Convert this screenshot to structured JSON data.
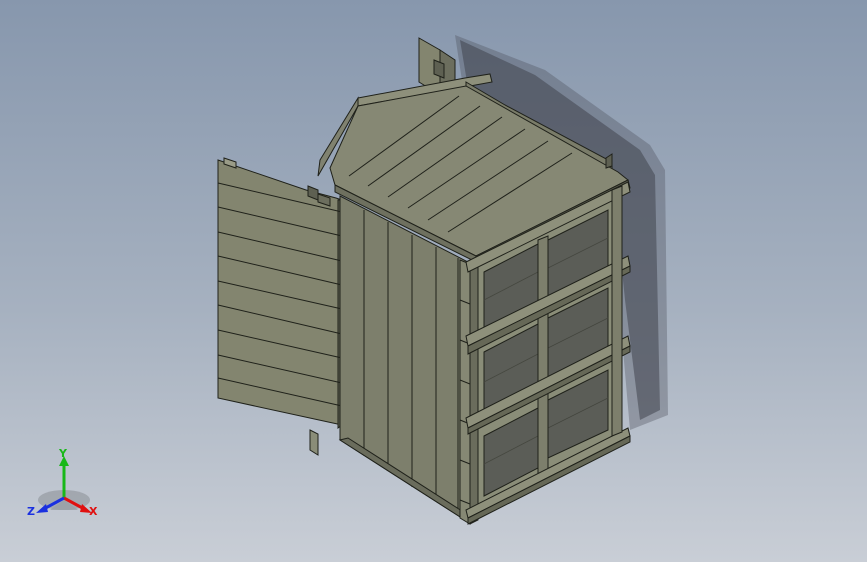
{
  "viewport": {
    "model": "wooden-shed-assembly",
    "view": "isometric",
    "display_style": "shaded-with-edges",
    "background_colors": [
      "#8797ad",
      "#c9ced6"
    ],
    "model_colors": {
      "wall_front": "#7d7f6c",
      "wall_side": "#8a8d78",
      "roof_top": "#868874",
      "panel_dark": "#5b5d57",
      "edge": "#1f211a",
      "shadow": "#3c3f48"
    }
  },
  "triad": {
    "x_label": "X",
    "y_label": "Y",
    "z_label": "Z",
    "x_color": "#e01010",
    "y_color": "#18b818",
    "z_color": "#1a30e0"
  }
}
